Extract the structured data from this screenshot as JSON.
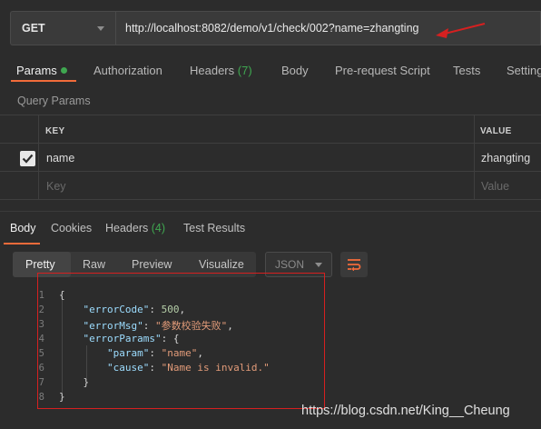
{
  "request": {
    "method": "GET",
    "url": "http://localhost:8082/demo/v1/check/002?name=zhangting"
  },
  "request_tabs": [
    {
      "label": "Params",
      "active": true
    },
    {
      "label": "Authorization"
    },
    {
      "label": "Headers",
      "count": "(7)"
    },
    {
      "label": "Body"
    },
    {
      "label": "Pre-request Script"
    },
    {
      "label": "Tests"
    },
    {
      "label": "Setting"
    }
  ],
  "query_params": {
    "title": "Query Params",
    "columns": [
      "KEY",
      "VALUE"
    ],
    "rows": [
      {
        "checked": true,
        "key": "name",
        "value": "zhangting"
      }
    ],
    "placeholder_key": "Key",
    "placeholder_value": "Value"
  },
  "response_tabs": [
    {
      "label": "Body",
      "active": true
    },
    {
      "label": "Cookies"
    },
    {
      "label": "Headers",
      "count": "(4)"
    },
    {
      "label": "Test Results"
    }
  ],
  "view_modes": [
    "Pretty",
    "Raw",
    "Preview",
    "Visualize"
  ],
  "format_select": "JSON",
  "code_lines": [
    {
      "n": "1"
    },
    {
      "n": "2"
    },
    {
      "n": "3"
    },
    {
      "n": "4"
    },
    {
      "n": "5"
    },
    {
      "n": "6"
    },
    {
      "n": "7"
    },
    {
      "n": "8"
    }
  ],
  "response": {
    "errorCode_key": "\"errorCode\"",
    "errorCode_val": "500",
    "errorMsg_key": "\"errorMsg\"",
    "errorMsg_val": "\"参数校验失败\"",
    "errorParams_key": "\"errorParams\"",
    "param_key": "\"param\"",
    "param_val": "\"name\"",
    "cause_key": "\"cause\"",
    "cause_val": "\"Name is invalid.\""
  },
  "watermark": "https://blog.csdn.net/King__Cheung",
  "colors": {
    "accent": "#f26b3a",
    "success": "#3fa750",
    "annotation": "#d62020"
  }
}
